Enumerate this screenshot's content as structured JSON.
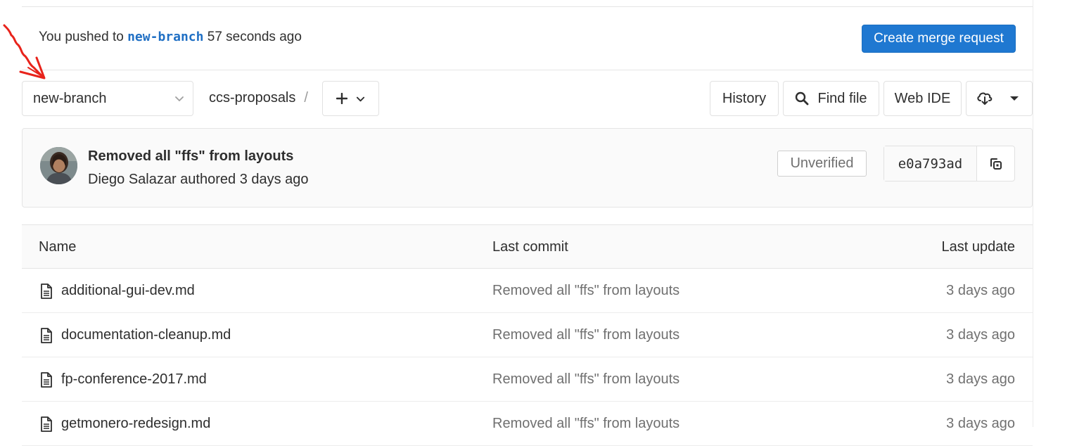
{
  "push_banner": {
    "prefix": "You pushed to",
    "branch": "new-branch",
    "suffix": "57 seconds ago",
    "button_label": "Create merge request"
  },
  "toolbar": {
    "branch_selector_value": "new-branch",
    "breadcrumb_project": "ccs-proposals",
    "breadcrumb_separator": "/",
    "add_icon": "plus-icon",
    "history_label": "History",
    "find_file_label": "Find file",
    "web_ide_label": "Web IDE",
    "download_icon": "cloud-download-icon"
  },
  "last_commit": {
    "title": "Removed all \"ffs\" from layouts",
    "author_line": "Diego Salazar authored 3 days ago",
    "signature_badge": "Unverified",
    "sha": "e0a793ad",
    "copy_icon": "copy-icon"
  },
  "file_table": {
    "headers": {
      "name": "Name",
      "last_commit": "Last commit",
      "last_update": "Last update"
    },
    "rows": [
      {
        "name": "additional-gui-dev.md",
        "commit": "Removed all \"ffs\" from layouts",
        "updated": "3 days ago"
      },
      {
        "name": "documentation-cleanup.md",
        "commit": "Removed all \"ffs\" from layouts",
        "updated": "3 days ago"
      },
      {
        "name": "fp-conference-2017.md",
        "commit": "Removed all \"ffs\" from layouts",
        "updated": "3 days ago"
      },
      {
        "name": "getmonero-redesign.md",
        "commit": "Removed all \"ffs\" from layouts",
        "updated": "3 days ago"
      }
    ]
  },
  "colors": {
    "primary_button": "#1f78d1",
    "branch_link": "#1f6fc4",
    "annotation_arrow": "#e8231b"
  }
}
